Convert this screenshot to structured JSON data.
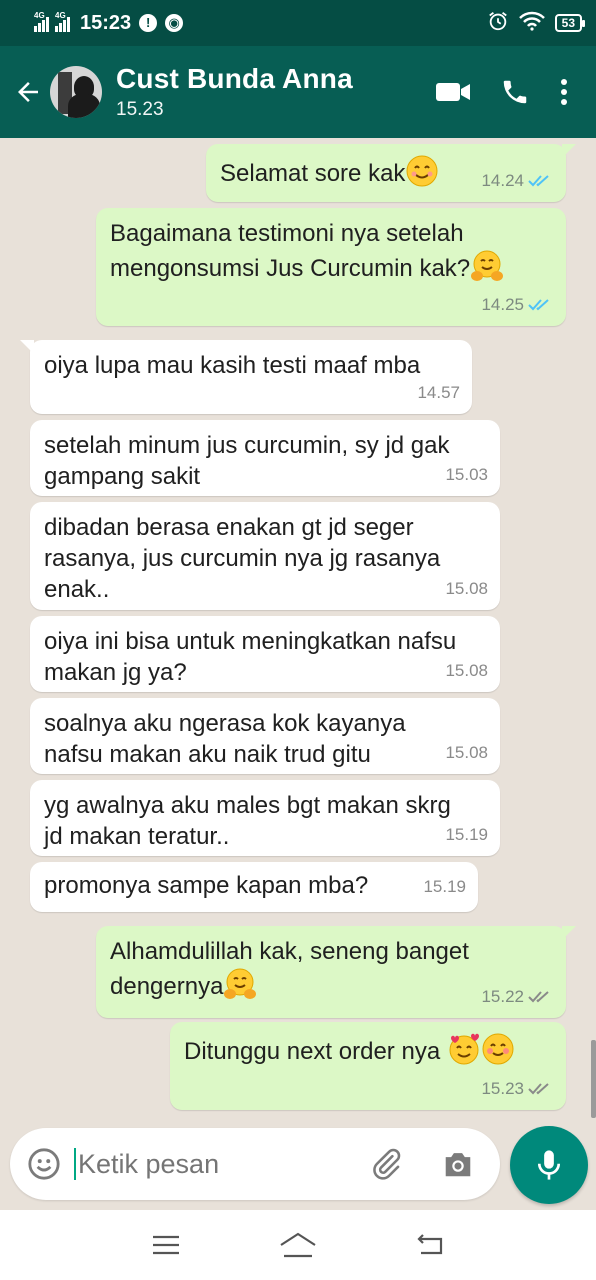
{
  "status_bar": {
    "network1": "4G",
    "network2": "4G",
    "time": "15:23",
    "battery": "53"
  },
  "header": {
    "contact_name": "Cust Bunda Anna",
    "last_seen": "15.23"
  },
  "messages": [
    {
      "direction": "out",
      "text": "Selamat sore kak",
      "emoji": [
        "smiling-face"
      ],
      "time": "14.24",
      "status": "read"
    },
    {
      "direction": "out",
      "text": "Bagaimana testimoni nya setelah mengonsumsi Jus Curcumin kak?",
      "emoji": [
        "hugging-face"
      ],
      "time": "14.25",
      "status": "read"
    },
    {
      "direction": "in",
      "text": "oiya lupa mau kasih testi maaf mba",
      "time": "14.57"
    },
    {
      "direction": "in",
      "text": "setelah minum jus curcumin, sy jd gak gampang sakit",
      "time": "15.03"
    },
    {
      "direction": "in",
      "text": "dibadan berasa enakan gt jd seger rasanya, jus curcumin nya jg rasanya enak..",
      "time": "15.08"
    },
    {
      "direction": "in",
      "text": "oiya ini bisa untuk meningkatkan nafsu makan jg ya?",
      "time": "15.08"
    },
    {
      "direction": "in",
      "text": "soalnya aku ngerasa kok kayanya nafsu makan aku naik trud gitu",
      "time": "15.08"
    },
    {
      "direction": "in",
      "text": "yg awalnya aku males bgt makan skrg jd makan teratur..",
      "time": "15.19"
    },
    {
      "direction": "in",
      "text": "promonya sampe kapan mba?",
      "time": "15.19"
    },
    {
      "direction": "out",
      "text": "Alhamdulillah kak, seneng banget dengernya",
      "emoji": [
        "hugging-face"
      ],
      "time": "15.22",
      "status": "delivered"
    },
    {
      "direction": "out",
      "text": "Ditunggu next order nya ",
      "emoji": [
        "smiling-face-with-hearts",
        "smiling-face-blush"
      ],
      "time": "15.23",
      "status": "delivered"
    }
  ],
  "input": {
    "placeholder": "Ketik pesan"
  },
  "colors": {
    "header": "#075e54",
    "status_bar": "#054d44",
    "outgoing_bubble": "#dcf8c6",
    "incoming_bubble": "#ffffff",
    "read_tick": "#4fc3f7",
    "mic_button": "#00897b"
  }
}
